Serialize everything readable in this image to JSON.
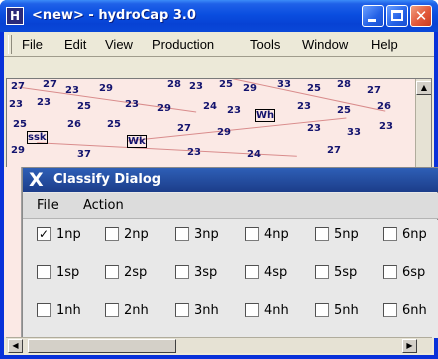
{
  "main_window": {
    "title": "<new> - hydroCap 3.0",
    "app_icon": "hydrocap-icon",
    "controls": {
      "minimize": "minimize-icon",
      "maximize": "maximize-icon",
      "close": "close-icon"
    }
  },
  "main_menu": {
    "items": [
      "File",
      "Edit",
      "View",
      "Production",
      "Tools",
      "Window",
      "Help"
    ]
  },
  "map": {
    "labels": [
      "27",
      "27",
      "23",
      "29",
      "28",
      "23",
      "25",
      "29",
      "33",
      "25",
      "28",
      "27",
      "23",
      "23",
      "25",
      "23",
      "Wh",
      "29",
      "24",
      "23",
      "Wk",
      "23",
      "25",
      "26",
      "25",
      "26",
      "ssk",
      "25",
      "27",
      "29",
      "23",
      "33",
      "23",
      "29",
      "37",
      "23",
      "24",
      "27"
    ],
    "colors": {
      "background": "#fbe9e5",
      "label": "#14146e",
      "lines": "#d98c8c"
    }
  },
  "classify_dialog": {
    "title": "Classify Dialog",
    "title_icon": "x-window-icon",
    "menu": [
      "File",
      "Action"
    ],
    "rows": [
      [
        {
          "label": "1np",
          "checked": true
        },
        {
          "label": "2np",
          "checked": false
        },
        {
          "label": "3np",
          "checked": false
        },
        {
          "label": "4np",
          "checked": false
        },
        {
          "label": "5np",
          "checked": false
        },
        {
          "label": "6np",
          "checked": false
        }
      ],
      [
        {
          "label": "1sp",
          "checked": false
        },
        {
          "label": "2sp",
          "checked": false
        },
        {
          "label": "3sp",
          "checked": false
        },
        {
          "label": "4sp",
          "checked": false
        },
        {
          "label": "5sp",
          "checked": false
        },
        {
          "label": "6sp",
          "checked": false
        }
      ],
      [
        {
          "label": "1nh",
          "checked": false
        },
        {
          "label": "2nh",
          "checked": false
        },
        {
          "label": "3nh",
          "checked": false
        },
        {
          "label": "4nh",
          "checked": false
        },
        {
          "label": "5nh",
          "checked": false
        },
        {
          "label": "6nh",
          "checked": false
        }
      ]
    ],
    "check_glyph": "✓"
  },
  "scrollbar": {
    "left_arrow": "◀",
    "right_arrow": "▶",
    "up_arrow": "▲"
  }
}
